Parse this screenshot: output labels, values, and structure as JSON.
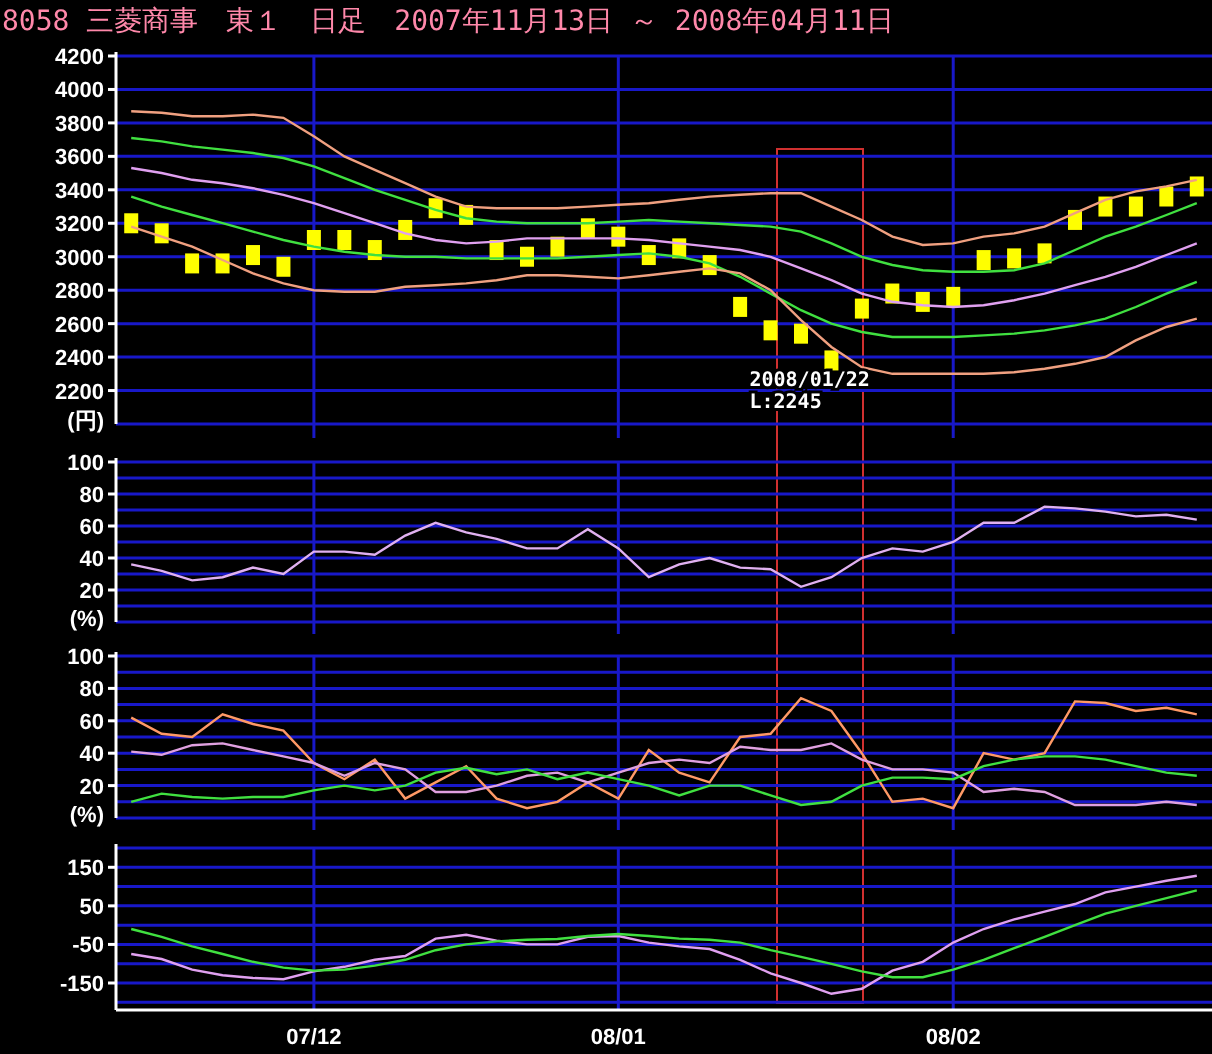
{
  "title": "8058 三菱商事　東１　日足　2007年11月13日 ～ 2008年04月11日",
  "panels": [
    {
      "chart_data": {
        "type": "line",
        "grid": true,
        "ylabel": "(円)",
        "ylim": [
          2000,
          4200
        ],
        "yticks": [
          2200,
          2400,
          2600,
          2800,
          3000,
          3200,
          3400,
          3600,
          3800,
          4000,
          4200
        ],
        "annotations": [
          {
            "text": "2008/01/22"
          },
          {
            "text": "L:2245"
          }
        ],
        "series": [
          {
            "color": "#f0a080",
            "values": [
              3870,
              3860,
              3840,
              3840,
              3850,
              3830,
              3720,
              3600,
              3520,
              3440,
              3360,
              3300,
              3290,
              3290,
              3290,
              3300,
              3310,
              3320,
              3340,
              3360,
              3370,
              3380,
              3380,
              3300,
              3220,
              3120,
              3070,
              3080,
              3120,
              3140,
              3180,
              3260,
              3340,
              3390,
              3420,
              3460
            ]
          },
          {
            "color": "#40e040",
            "values": [
              3710,
              3690,
              3660,
              3640,
              3620,
              3590,
              3540,
              3470,
              3400,
              3340,
              3280,
              3230,
              3210,
              3200,
              3200,
              3200,
              3210,
              3220,
              3210,
              3200,
              3190,
              3180,
              3150,
              3080,
              3000,
              2950,
              2920,
              2910,
              2910,
              2920,
              2960,
              3040,
              3120,
              3180,
              3250,
              3320
            ]
          },
          {
            "color": "#e0a0f0",
            "values": [
              3530,
              3500,
              3460,
              3440,
              3410,
              3370,
              3320,
              3260,
              3200,
              3140,
              3100,
              3080,
              3090,
              3110,
              3110,
              3110,
              3110,
              3100,
              3080,
              3060,
              3040,
              3000,
              2930,
              2860,
              2780,
              2730,
              2710,
              2700,
              2710,
              2740,
              2780,
              2830,
              2880,
              2940,
              3010,
              3080
            ]
          },
          {
            "color": "#40e040",
            "values": [
              3360,
              3300,
              3250,
              3200,
              3150,
              3100,
              3060,
              3030,
              3010,
              3000,
              3000,
              2990,
              2990,
              2990,
              2990,
              3000,
              3010,
              3020,
              3000,
              2960,
              2880,
              2780,
              2680,
              2600,
              2550,
              2520,
              2520,
              2520,
              2530,
              2540,
              2560,
              2590,
              2630,
              2700,
              2780,
              2850
            ]
          },
          {
            "color": "#f0a080",
            "values": [
              3180,
              3120,
              3060,
              2980,
              2900,
              2840,
              2800,
              2790,
              2790,
              2820,
              2830,
              2840,
              2860,
              2890,
              2890,
              2880,
              2870,
              2890,
              2910,
              2930,
              2900,
              2800,
              2620,
              2460,
              2340,
              2300,
              2300,
              2300,
              2300,
              2310,
              2330,
              2360,
              2400,
              2500,
              2580,
              2630
            ]
          },
          {
            "type": "scatter",
            "color": "#ffff00",
            "values": [
              3200,
              3140,
              2960,
              2960,
              3010,
              2940,
              3100,
              3100,
              3040,
              3160,
              3290,
              3250,
              3040,
              3000,
              3060,
              3170,
              3120,
              3010,
              3050,
              2950,
              2700,
              2560,
              2540,
              2380,
              2690,
              2780,
              2730,
              2760,
              2980,
              2990,
              3020,
              3220,
              3300,
              3300,
              3360,
              3420
            ]
          }
        ]
      }
    },
    {
      "chart_data": {
        "type": "line",
        "grid": true,
        "ylabel": "(%)",
        "ylim": [
          0,
          100
        ],
        "yticks": [
          20,
          40,
          60,
          80,
          100
        ],
        "series": [
          {
            "color": "#e0b0f0",
            "values": [
              36,
              32,
              26,
              28,
              34,
              30,
              44,
              44,
              42,
              54,
              62,
              56,
              52,
              46,
              46,
              58,
              46,
              28,
              36,
              40,
              34,
              33,
              22,
              28,
              40,
              46,
              44,
              50,
              62,
              62,
              72,
              71,
              69,
              66,
              67,
              64
            ]
          }
        ]
      }
    },
    {
      "chart_data": {
        "type": "line",
        "grid": true,
        "ylabel": "(%)",
        "ylim": [
          0,
          100
        ],
        "yticks": [
          20,
          40,
          60,
          80,
          100
        ],
        "series": [
          {
            "color": "#ff9966",
            "values": [
              62,
              52,
              50,
              64,
              58,
              54,
              34,
              24,
              36,
              12,
              22,
              32,
              12,
              6,
              10,
              22,
              12,
              42,
              28,
              22,
              50,
              52,
              74,
              66,
              40,
              10,
              12,
              6,
              40,
              36,
              40,
              72,
              71,
              66,
              68,
              64
            ]
          },
          {
            "color": "#e0a0e0",
            "values": [
              41,
              39,
              45,
              46,
              42,
              38,
              34,
              26,
              34,
              30,
              16,
              16,
              20,
              26,
              28,
              22,
              28,
              34,
              36,
              34,
              44,
              42,
              42,
              46,
              36,
              30,
              30,
              28,
              16,
              18,
              16,
              8,
              8,
              8,
              10,
              8
            ]
          },
          {
            "color": "#40e040",
            "values": [
              10,
              15,
              13,
              12,
              13,
              13,
              17,
              20,
              17,
              20,
              28,
              31,
              27,
              30,
              24,
              28,
              24,
              20,
              14,
              20,
              20,
              14,
              8,
              10,
              20,
              25,
              25,
              24,
              32,
              36,
              38,
              38,
              36,
              32,
              28,
              26
            ]
          }
        ]
      }
    },
    {
      "chart_data": {
        "type": "line",
        "grid": true,
        "ylim": [
          -220,
          200
        ],
        "yticks": [
          -150,
          -50,
          50,
          150
        ],
        "categories": [
          null,
          null,
          null,
          null,
          null,
          null,
          "07/12",
          null,
          null,
          null,
          null,
          null,
          null,
          null,
          null,
          null,
          "08/01",
          null,
          null,
          null,
          null,
          null,
          null,
          null,
          null,
          null,
          null,
          "08/02",
          null,
          null,
          null,
          null,
          null,
          null,
          null,
          null
        ],
        "series": [
          {
            "color": "#e0a0f0",
            "values": [
              -75,
              -88,
              -115,
              -130,
              -137,
              -140,
              -120,
              -108,
              -90,
              -80,
              -35,
              -25,
              -40,
              -50,
              -50,
              -30,
              -28,
              -45,
              -55,
              -62,
              -90,
              -125,
              -150,
              -178,
              -165,
              -118,
              -95,
              -45,
              -10,
              15,
              35,
              55,
              85,
              100,
              115,
              128
            ]
          },
          {
            "color": "#40e040",
            "values": [
              -10,
              -30,
              -55,
              -75,
              -95,
              -110,
              -118,
              -115,
              -105,
              -90,
              -65,
              -50,
              -42,
              -38,
              -36,
              -28,
              -23,
              -28,
              -35,
              -38,
              -45,
              -65,
              -82,
              -100,
              -120,
              -135,
              -135,
              -115,
              -90,
              -60,
              -30,
              0,
              30,
              50,
              70,
              90
            ]
          }
        ]
      }
    }
  ]
}
